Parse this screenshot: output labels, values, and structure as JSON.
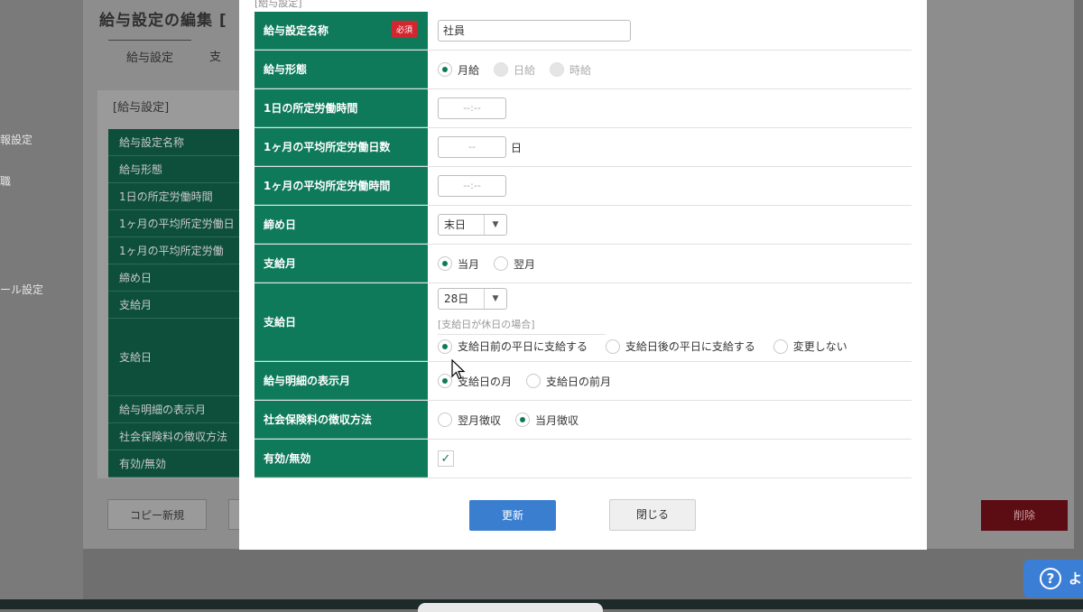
{
  "background": {
    "page_title": "給与設定の編集",
    "page_title_suffix": "[",
    "tabs": [
      "給与設定",
      "支"
    ],
    "sidebar_items": [
      "報設定",
      "職",
      "ール設定"
    ],
    "section_title": "[給与設定]",
    "table_rows": [
      "給与設定名称",
      "給与形態",
      "1日の所定労働時間",
      "1ヶ月の平均所定労働日",
      "1ヶ月の平均所定労働",
      "締め日",
      "支給月",
      "支給日",
      "給与明細の表示月",
      "社会保険料の徴収方法",
      "有効/無効"
    ],
    "copy_button": "コピー新規",
    "delete_button": "削除",
    "help_text": "よ"
  },
  "modal": {
    "section_title": "[給与設定]",
    "rows": {
      "name": {
        "label": "給与設定名称",
        "required": "必須",
        "value": "社員"
      },
      "pay_type": {
        "label": "給与形態",
        "options": [
          "月給",
          "日給",
          "時給"
        ]
      },
      "daily_hours": {
        "label": "1日の所定労働時間",
        "placeholder": "--:--"
      },
      "monthly_days": {
        "label": "1ヶ月の平均所定労働日数",
        "placeholder": "--",
        "unit": "日"
      },
      "monthly_hours": {
        "label": "1ヶ月の平均所定労働時間",
        "placeholder": "--:--"
      },
      "closing_day": {
        "label": "締め日",
        "value": "末日"
      },
      "pay_month": {
        "label": "支給月",
        "options": [
          "当月",
          "翌月"
        ]
      },
      "pay_day": {
        "label": "支給日",
        "value": "28日",
        "holiday_legend": "[支給日が休日の場合]",
        "holiday_options": [
          "支給日前の平日に支給する",
          "支給日後の平日に支給する",
          "変更しない"
        ]
      },
      "slip_month": {
        "label": "給与明細の表示月",
        "options": [
          "支給日の月",
          "支給日の前月"
        ]
      },
      "social_insurance": {
        "label": "社会保険料の徴収方法",
        "options": [
          "翌月徴収",
          "当月徴収"
        ]
      },
      "active": {
        "label": "有効/無効"
      }
    },
    "update_button": "更新",
    "close_button": "閉じる"
  },
  "colors": {
    "label_bg": "#0f7a5a",
    "primary_button": "#3a7ed0",
    "required_badge": "#d3262f",
    "delete_button": "#5c0c13"
  }
}
